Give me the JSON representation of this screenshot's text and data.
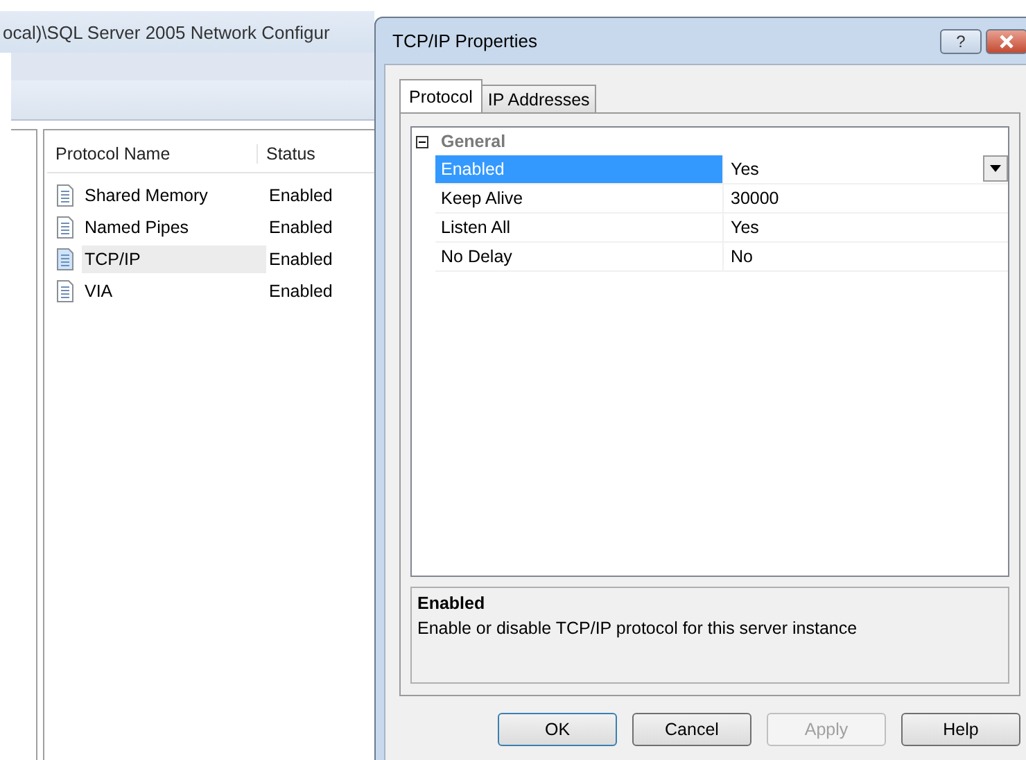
{
  "background_window": {
    "title": "ocal)\\SQL Server 2005 Network Configur",
    "table": {
      "columns": [
        "Protocol Name",
        "Status"
      ],
      "rows": [
        {
          "name": "Shared Memory",
          "status": "Enabled",
          "selected": false
        },
        {
          "name": "Named Pipes",
          "status": "Enabled",
          "selected": false
        },
        {
          "name": "TCP/IP",
          "status": "Enabled",
          "selected": true
        },
        {
          "name": "VIA",
          "status": "Enabled",
          "selected": false
        }
      ]
    }
  },
  "dialog": {
    "title": "TCP/IP Properties",
    "help_button": "?",
    "tabs": [
      {
        "label": "Protocol",
        "selected": true
      },
      {
        "label": "IP Addresses",
        "selected": false
      }
    ],
    "property_grid": {
      "category": "General",
      "expanded": true,
      "properties": [
        {
          "name": "Enabled",
          "value": "Yes",
          "selected": true
        },
        {
          "name": "Keep Alive",
          "value": "30000",
          "selected": false
        },
        {
          "name": "Listen All",
          "value": "Yes",
          "selected": false
        },
        {
          "name": "No Delay",
          "value": "No",
          "selected": false
        }
      ]
    },
    "description": {
      "title": "Enabled",
      "text": "Enable or disable TCP/IP protocol for this server instance"
    },
    "buttons": [
      {
        "label": "OK",
        "disabled": false
      },
      {
        "label": "Cancel",
        "disabled": false
      },
      {
        "label": "Apply",
        "disabled": true
      },
      {
        "label": "Help",
        "disabled": false
      }
    ]
  }
}
